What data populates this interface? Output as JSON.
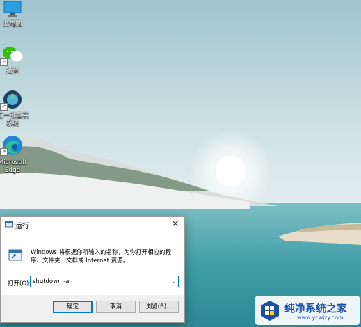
{
  "desktop": {
    "icons": [
      {
        "label": "此电脑",
        "icon": "this-pc-icon"
      },
      {
        "label": "微信",
        "icon": "wechat-icon"
      },
      {
        "label_lines": [
          "汇一键重装",
          "系统"
        ],
        "icon": "reinstall-tool-icon"
      },
      {
        "label_lines": [
          "Microsoft",
          "Edge"
        ],
        "icon": "edge-icon"
      }
    ]
  },
  "run_dialog": {
    "title": "运行",
    "close_glyph": "✕",
    "description": "Windows 将根据你所输入的名称，为你打开相应的程序、文件夹、文档或 Internet 资源。",
    "open_label": "打开(O):",
    "command_value": "shutdown -a",
    "buttons": {
      "ok": "确定",
      "cancel": "取消",
      "browse": "浏览(B)..."
    }
  },
  "watermark": {
    "title": "纯净系统之家",
    "url": "www.ycwjzy.com"
  },
  "colors": {
    "sky": "#bcd6dd",
    "water": "#4fa4ad",
    "accent": "#0078d4",
    "dialog_bg": "#f0f0f0"
  }
}
